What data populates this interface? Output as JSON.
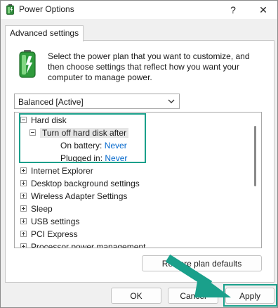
{
  "window": {
    "title": "Power Options",
    "help_glyph": "?",
    "close_glyph": "✕"
  },
  "tab": {
    "label": "Advanced settings"
  },
  "description": "Select the power plan that you want to customize, and then choose settings that reflect how you want your computer to manage power.",
  "plan_select": {
    "value": "Balanced [Active]"
  },
  "tree": {
    "hard_disk": "Hard disk",
    "turn_off": "Turn off hard disk after",
    "on_battery_label": "On battery:",
    "on_battery_value": "Never",
    "plugged_in_label": "Plugged in:",
    "plugged_in_value": "Never",
    "items": [
      "Internet Explorer",
      "Desktop background settings",
      "Wireless Adapter Settings",
      "Sleep",
      "USB settings",
      "PCI Express",
      "Processor power management"
    ]
  },
  "buttons": {
    "restore": "Restore plan defaults",
    "ok": "OK",
    "cancel": "Cancel",
    "apply": "Apply"
  },
  "colors": {
    "highlight": "#1aa08b",
    "link": "#0066cc"
  }
}
